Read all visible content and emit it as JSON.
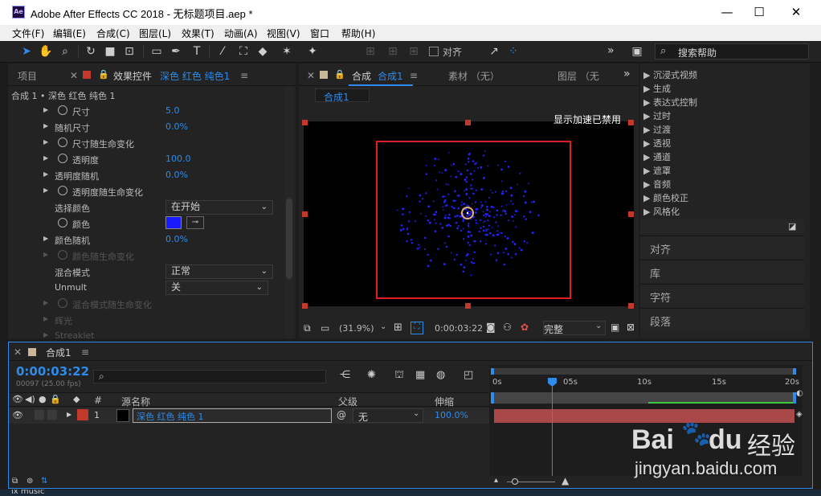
{
  "window": {
    "app_icon": "Ae",
    "title": "Adobe After Effects CC 2018 - 无标题项目.aep *",
    "minimize": "—",
    "maximize": "☐",
    "close": "✕"
  },
  "menu": [
    "文件(F)",
    "编辑(E)",
    "合成(C)",
    "图层(L)",
    "效果(T)",
    "动画(A)",
    "视图(V)",
    "窗口",
    "帮助(H)"
  ],
  "toolbar": {
    "snap_label": "对齐",
    "search_label": "搜索帮助",
    "overflow": "»"
  },
  "project_tab": "项目",
  "effects_panel": {
    "tab_prefix": "效果控件",
    "tab_layer": "深色 红色 纯色1",
    "breadcrumb": "合成 1 • 深色 红色 纯色 1",
    "rows": [
      {
        "name": "尺寸",
        "value": "5.0",
        "stopwatch": true
      },
      {
        "name": "随机尺寸",
        "value": "0.0%",
        "stopwatch": false
      },
      {
        "name": "尺寸随生命变化",
        "value": "",
        "stopwatch": true
      },
      {
        "name": "透明度",
        "value": "100.0",
        "stopwatch": true
      },
      {
        "name": "透明度随机",
        "value": "0.0%",
        "stopwatch": false
      },
      {
        "name": "透明度随生命变化",
        "value": "",
        "stopwatch": true
      }
    ],
    "select_color_label": "选择颜色",
    "select_color_value": "在开始",
    "color_label": "颜色",
    "color_swatch": "#1a1aff",
    "color_random_label": "颜色随机",
    "color_random_value": "0.0%",
    "color_over_life": "颜色随生命变化",
    "blend_mode_label": "混合模式",
    "blend_mode_value": "正常",
    "unmult_label": "Unmult",
    "unmult_value": "关",
    "blend_over_life": "混合模式随生命变化",
    "glow_label": "辉光",
    "streaklet_label": "Streaklet"
  },
  "comp_panel": {
    "tab_prefix": "合成",
    "tab_name": "合成1",
    "footage_tab": "素材 （无）",
    "layer_tab": "图层 （无",
    "subtab": "合成1",
    "accel_notice": "显示加速已禁用",
    "zoom": "(31.9%)",
    "timecode": "0:00:03:22",
    "quality": "完整"
  },
  "effects_presets": {
    "items": [
      "沉浸式视频",
      "生成",
      "表达式控制",
      "过时",
      "过渡",
      "透视",
      "通道",
      "遮罩",
      "音频",
      "颜色校正",
      "风格化"
    ],
    "sections": [
      "对齐",
      "库",
      "字符",
      "段落"
    ]
  },
  "timeline": {
    "tab": "合成1",
    "timecode": "0:00:03:22",
    "frame_info": "00097 (25.00 fps)",
    "col_number": "#",
    "col_source": "源名称",
    "col_parent": "父级",
    "col_stretch": "伸缩",
    "ruler": [
      "0s",
      "05s",
      "10s",
      "15s",
      "20s"
    ],
    "layer": {
      "index": "1",
      "name": "深色 红色 纯色 1",
      "parent": "无",
      "stretch": "100.0%",
      "label_color": "#c0392b"
    }
  },
  "watermark": {
    "brand": "Bai",
    "brand2": "du",
    "brand3": "经验",
    "url": "jingyan.baidu.com"
  },
  "taskbar_text": "lx music"
}
